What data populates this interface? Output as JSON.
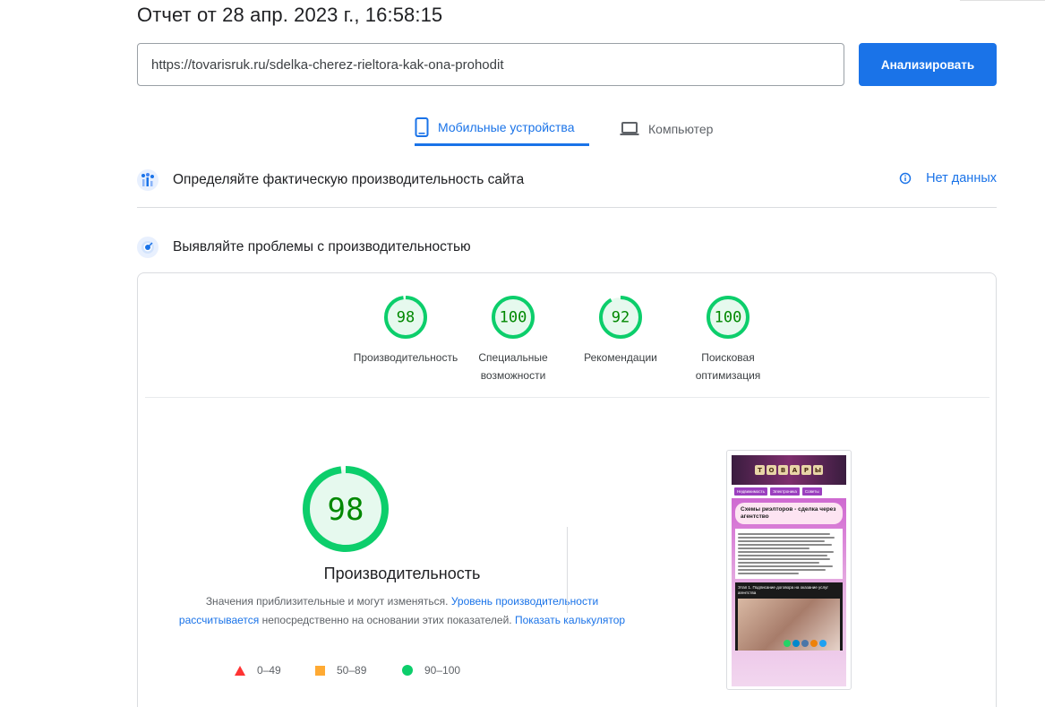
{
  "report": {
    "title": "Отчет от 28 апр. 2023 г., 16:58:15"
  },
  "search": {
    "url_value": "https://tovarisruk.ru/sdelka-cherez-rieltora-kak-ona-prohodit",
    "analyze_label": "Анализировать"
  },
  "tabs": [
    {
      "label": "Мобильные устройства",
      "icon": "smartphone-icon",
      "active": true
    },
    {
      "label": "Компьютер",
      "icon": "laptop-icon",
      "active": false
    }
  ],
  "field_data": {
    "title": "Определяйте фактическую производительность сайта",
    "status": "Нет данных",
    "icon": "people-chart-icon"
  },
  "lab_data": {
    "title": "Выявляйте проблемы с производительностью",
    "icon": "lighthouse-icon"
  },
  "scores": [
    {
      "value": "98",
      "label_lines": [
        "Производительность"
      ],
      "fraction": 0.98
    },
    {
      "value": "100",
      "label_lines": [
        "Специальные",
        "возможности"
      ],
      "fraction": 1.0
    },
    {
      "value": "92",
      "label_lines": [
        "Рекомендации"
      ],
      "fraction": 0.92
    },
    {
      "value": "100",
      "label_lines": [
        "Поисковая",
        "оптимизация"
      ],
      "fraction": 1.0
    }
  ],
  "performance": {
    "score": "98",
    "fraction": 0.98,
    "label": "Производительность",
    "desc_part1": "Значения приблизительные и могут изменяться.",
    "desc_link1": "Уровень производительности рассчитывается",
    "desc_part2": "непосредственно на основании этих показателей.",
    "desc_link2": "Показать калькулятор"
  },
  "legend": [
    {
      "range": "0–49",
      "shape": "triangle",
      "color": "#ff3333"
    },
    {
      "range": "50–89",
      "shape": "square",
      "color": "#ffaa33"
    },
    {
      "range": "90–100",
      "shape": "circle",
      "color": "#0cce6b"
    }
  ],
  "screenshot": {
    "logo_letters": [
      "Т",
      "О",
      "В",
      "А",
      "Р",
      "Ы"
    ],
    "nav_items": [
      "Недвижимость",
      "Электроника",
      "Советы"
    ],
    "article_title": "Схемы риэлторов - сделка через агентство",
    "dark_caption": "Этап 1. Подписание договора на оказание услуг агентства"
  },
  "colors": {
    "accent": "#1a73e8",
    "pass_green": "#0cce6b",
    "pass_text": "#008800",
    "pass_fill": "#e6f9ee"
  }
}
